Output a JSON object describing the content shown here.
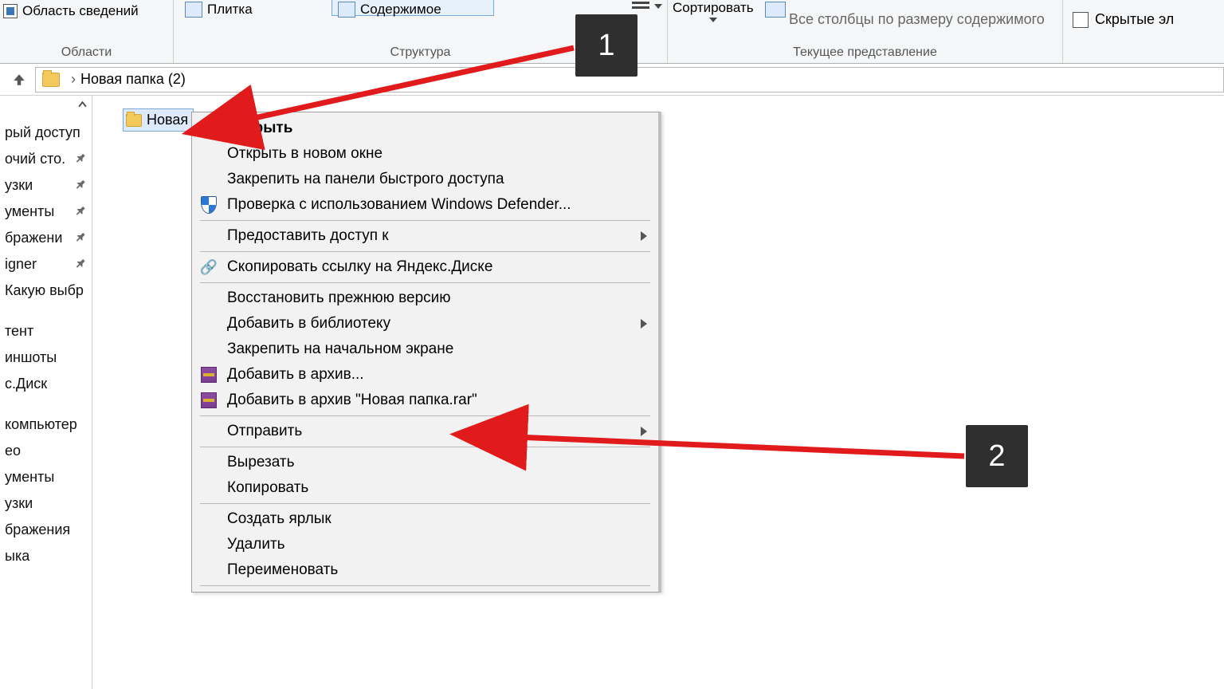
{
  "ribbon": {
    "details_pane": "Область сведений",
    "tile": "Плитка",
    "contents": "Содержимое",
    "group_areas": "Области",
    "group_structure": "Структура",
    "group_current": "Текущее представление",
    "sort": "Сортировать",
    "autosize_all": "Все столбцы по размеру содержимого",
    "hidden_items": "Скрытые эл"
  },
  "address": {
    "path": "Новая папка (2)"
  },
  "sidebar": {
    "items": [
      "рый доступ",
      "очий сто.",
      "узки",
      "ументы",
      "бражени",
      "igner",
      "Какую выбр",
      "",
      "тент",
      "иншоты",
      "с.Диск",
      "",
      "компьютер",
      "ео",
      "ументы",
      "узки",
      "бражения",
      "ыка"
    ],
    "pinned": [
      1,
      2,
      3,
      4,
      5
    ]
  },
  "target_folder": "Новая",
  "context_menu": {
    "open": "Открыть",
    "open_new": "Открыть в новом окне",
    "pin_quick": "Закрепить на панели быстрого доступа",
    "defender": "Проверка с использованием Windows Defender...",
    "share": "Предоставить доступ к",
    "yadisk": "Скопировать ссылку на Яндекс.Диске",
    "restore": "Восстановить прежнюю версию",
    "library": "Добавить в библиотеку",
    "pin_start": "Закрепить на начальном экране",
    "add_archive": "Добавить в архив...",
    "add_archive_named": "Добавить в архив \"Новая папка.rar\"",
    "send": "Отправить",
    "cut": "Вырезать",
    "copy": "Копировать",
    "shortcut": "Создать ярлык",
    "delete": "Удалить",
    "rename": "Переименовать"
  },
  "annotations": {
    "step1": "1",
    "step2": "2"
  }
}
